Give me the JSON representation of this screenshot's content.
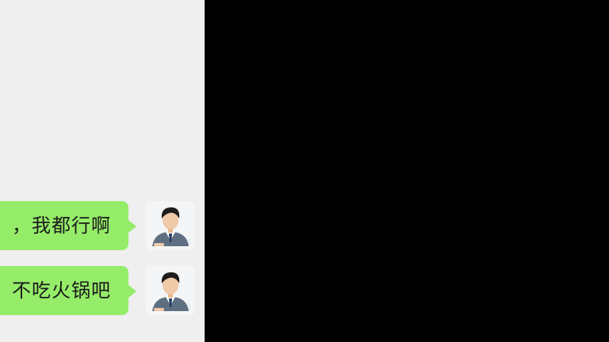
{
  "chat": {
    "messages": [
      {
        "text": "，我都行啊",
        "sender": "self",
        "avatar_icon": "businessman-avatar-icon"
      },
      {
        "text": "不吃火锅吧",
        "sender": "self",
        "avatar_icon": "businessman-avatar-icon"
      }
    ]
  },
  "colors": {
    "chat_background": "#efefef",
    "outgoing_bubble": "#95ec69",
    "message_text": "#1b1b1b",
    "outside_area": "#000000"
  }
}
